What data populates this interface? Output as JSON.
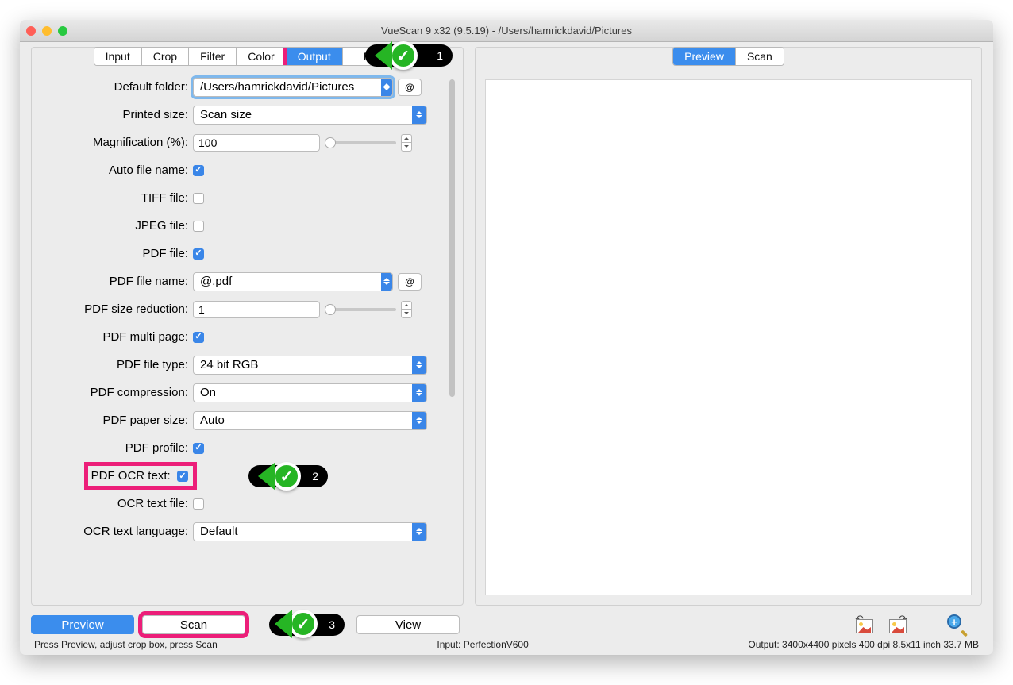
{
  "window": {
    "title": "VueScan 9 x32 (9.5.19) - /Users/hamrickdavid/Pictures"
  },
  "left_tabs": [
    "Input",
    "Crop",
    "Filter",
    "Color",
    "Output",
    "Prefs"
  ],
  "left_active_index": 4,
  "right_tabs": [
    "Preview",
    "Scan"
  ],
  "right_active_index": 0,
  "fields": {
    "default_folder": {
      "label": "Default folder:",
      "value": "/Users/hamrickdavid/Pictures"
    },
    "printed_size": {
      "label": "Printed size:",
      "value": "Scan size"
    },
    "magnification": {
      "label": "Magnification (%):",
      "value": "100"
    },
    "auto_file_name": {
      "label": "Auto file name:",
      "checked": true
    },
    "tiff_file": {
      "label": "TIFF file:",
      "checked": false
    },
    "jpeg_file": {
      "label": "JPEG file:",
      "checked": false
    },
    "pdf_file": {
      "label": "PDF file:",
      "checked": true
    },
    "pdf_file_name": {
      "label": "PDF file name:",
      "value": "@.pdf"
    },
    "pdf_size_reduction": {
      "label": "PDF size reduction:",
      "value": "1"
    },
    "pdf_multi_page": {
      "label": "PDF multi page:",
      "checked": true
    },
    "pdf_file_type": {
      "label": "PDF file type:",
      "value": "24 bit RGB"
    },
    "pdf_compression": {
      "label": "PDF compression:",
      "value": "On"
    },
    "pdf_paper_size": {
      "label": "PDF paper size:",
      "value": "Auto"
    },
    "pdf_profile": {
      "label": "PDF profile:",
      "checked": true
    },
    "pdf_ocr_text": {
      "label": "PDF OCR text:",
      "checked": true
    },
    "ocr_text_file": {
      "label": "OCR text file:",
      "checked": false
    },
    "ocr_text_language": {
      "label": "OCR text language:",
      "value": "Default"
    }
  },
  "buttons": {
    "preview": "Preview",
    "scan": "Scan",
    "view": "View"
  },
  "status": {
    "left": "Press Preview, adjust crop box, press Scan",
    "center": "Input: PerfectionV600",
    "right": "Output: 3400x4400 pixels 400 dpi 8.5x11 inch 33.7 MB"
  },
  "annotations": {
    "n1": "1",
    "n2": "2",
    "n3": "3"
  },
  "at_symbol": "@"
}
